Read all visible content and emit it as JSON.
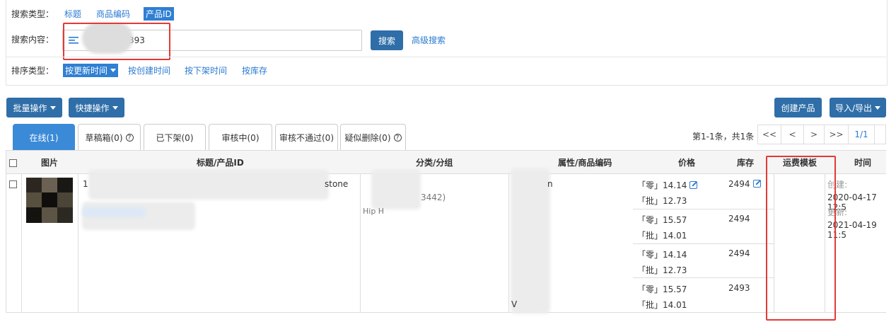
{
  "search": {
    "type_label": "搜索类型：",
    "types": [
      "标题",
      "商品编码",
      "产品ID"
    ],
    "content_label": "搜索内容：",
    "value": "393",
    "search_button": "搜索",
    "advanced": "高级搜索"
  },
  "sort": {
    "label": "排序类型：",
    "options": [
      "按更新时间",
      "按创建时间",
      "按下架时间",
      "按库存"
    ]
  },
  "toolbar": {
    "batch": "批量操作",
    "quick": "快捷操作",
    "create": "创建产品",
    "import_export": "导入/导出"
  },
  "tabs": [
    "在线(1)",
    "草稿箱(0)",
    "已下架(0)",
    "审核中(0)",
    "审核不通过(0)",
    "疑似删除(0)"
  ],
  "pager": {
    "summary": "第1-1条，共1条",
    "first": "<<",
    "prev": "<",
    "next": ">",
    "last": ">>",
    "page": "1/1"
  },
  "table": {
    "headers": [
      "图片",
      "标题/产品ID",
      "分类/分组",
      "属性/商品编码",
      "价格",
      "库存",
      "运费模板",
      "时间"
    ],
    "title_fragment": "stone",
    "title_prefix": "1",
    "category_fragment": "3442)",
    "category_line2": "Hip H",
    "attr_fragment": "n",
    "attr_last_fragment": "V",
    "rows": [
      {
        "retail": "「零」14.14",
        "wholesale": "「批」12.73",
        "stock": "2494"
      },
      {
        "retail": "「零」15.57",
        "wholesale": "「批」14.01",
        "stock": "2494"
      },
      {
        "retail": "「零」14.14",
        "wholesale": "「批」12.73",
        "stock": "2494"
      },
      {
        "retail": "「零」15.57",
        "wholesale": "「批」14.01",
        "stock": "2493"
      }
    ],
    "time": {
      "created_label": "创建:",
      "created": "2020-04-17 12:5",
      "updated_label": "更新:",
      "updated": "2021-04-19 11:5"
    }
  },
  "colors": {
    "primary": "#2f6ea8",
    "link": "#2b7bd1",
    "active_tab": "#3b8ad8",
    "highlight_box": "#e53935"
  }
}
